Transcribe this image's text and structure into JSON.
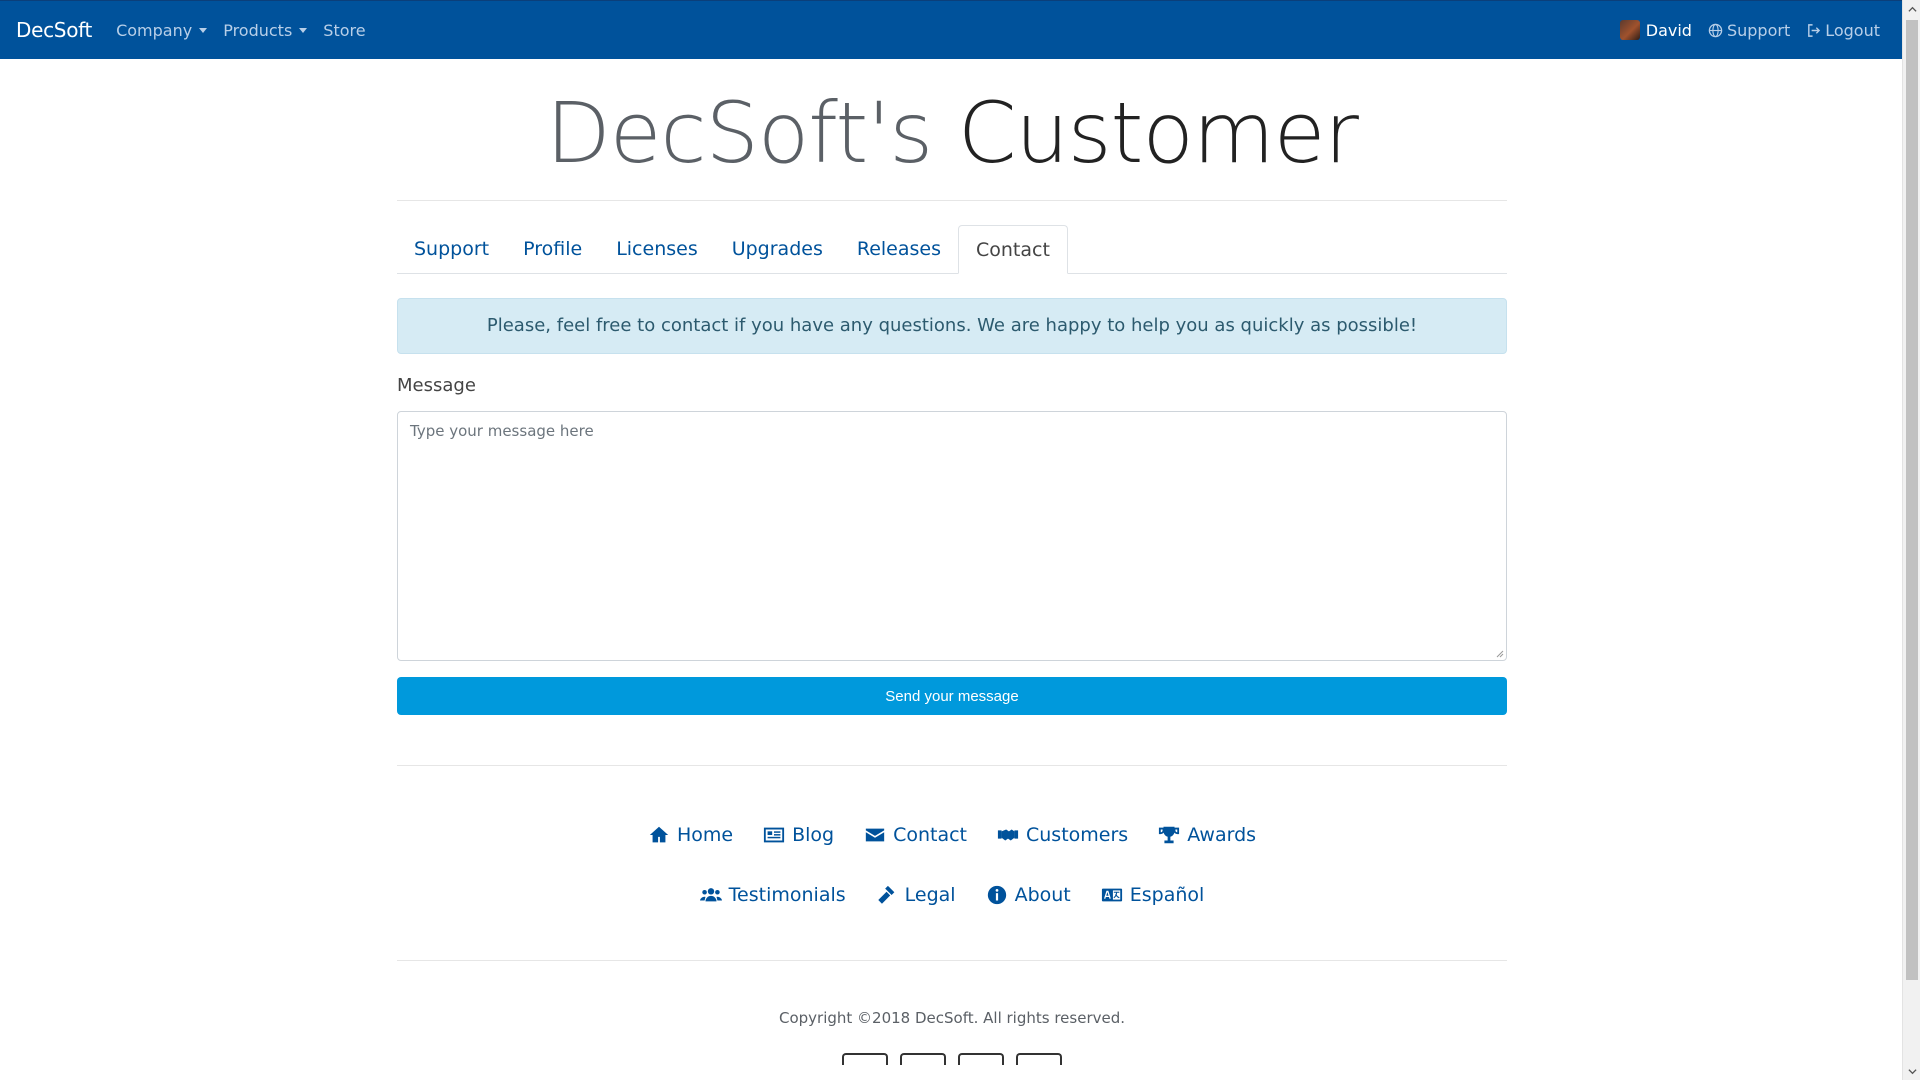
{
  "navbar": {
    "brand": "DecSoft",
    "left_items": [
      {
        "label": "Company",
        "dropdown": true
      },
      {
        "label": "Products",
        "dropdown": true
      },
      {
        "label": "Store",
        "dropdown": false
      }
    ],
    "user": "David",
    "support": "Support",
    "logout": "Logout",
    "bg_color": "#00529b"
  },
  "hero": {
    "title_part1": "DecSoft's",
    "title_part2": "Customer"
  },
  "tabs": [
    {
      "label": "Support",
      "active": false
    },
    {
      "label": "Profile",
      "active": false
    },
    {
      "label": "Licenses",
      "active": false
    },
    {
      "label": "Upgrades",
      "active": false
    },
    {
      "label": "Releases",
      "active": false
    },
    {
      "label": "Contact",
      "active": true
    }
  ],
  "contact": {
    "alert": "Please, feel free to contact if you have any questions. We are happy to help you as quickly as possible!",
    "message_label": "Message",
    "message_placeholder": "Type your message here",
    "message_value": "",
    "send_label": "Send your message",
    "send_color": "#0099dc"
  },
  "footer": {
    "links_row1": [
      {
        "label": "Home",
        "icon": "home-icon"
      },
      {
        "label": "Blog",
        "icon": "newspaper-icon"
      },
      {
        "label": "Contact",
        "icon": "envelope-icon"
      },
      {
        "label": "Customers",
        "icon": "handshake-icon"
      },
      {
        "label": "Awards",
        "icon": "trophy-icon"
      }
    ],
    "links_row2": [
      {
        "label": "Testimonials",
        "icon": "users-icon"
      },
      {
        "label": "Legal",
        "icon": "gavel-icon"
      },
      {
        "label": "About",
        "icon": "info-icon"
      },
      {
        "label": "Español",
        "icon": "language-icon"
      }
    ],
    "copyright": "Copyright ©2018 DecSoft. All rights reserved."
  }
}
